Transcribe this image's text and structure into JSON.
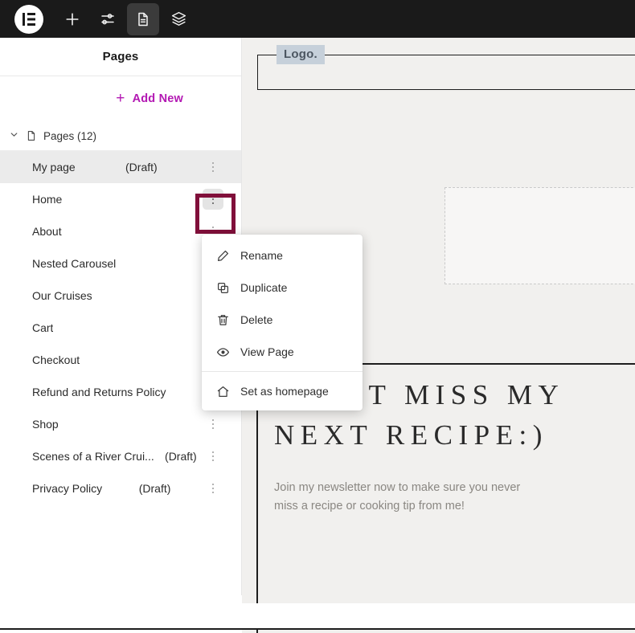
{
  "toolbar": {
    "items": [
      {
        "name": "elementor-logo",
        "label": "Elementor",
        "icon": "elementor-logo-icon"
      },
      {
        "name": "add-element",
        "label": "Add Element",
        "icon": "plus-icon"
      },
      {
        "name": "site-settings",
        "label": "Site Settings",
        "icon": "sliders-icon"
      },
      {
        "name": "pages",
        "label": "Pages",
        "icon": "document-icon",
        "active": true
      },
      {
        "name": "structure",
        "label": "Structure",
        "icon": "layers-icon"
      }
    ]
  },
  "panel": {
    "title": "Pages",
    "add_new_label": "Add New",
    "add_new_icon": "plus-icon",
    "group": {
      "label": "Pages (12)",
      "count": 12,
      "chevron_icon": "chevron-down-icon",
      "doc_icon": "document-icon",
      "expanded": true
    },
    "pages": [
      {
        "title": "My page",
        "status": "(Draft)",
        "selected": true,
        "kebab_highlight": false
      },
      {
        "title": "Home",
        "status": "",
        "selected": false,
        "kebab_highlight": true
      },
      {
        "title": "About",
        "status": "",
        "selected": false,
        "kebab_highlight": false
      },
      {
        "title": "Nested Carousel",
        "status": "",
        "selected": false,
        "kebab_highlight": false
      },
      {
        "title": "Our Cruises",
        "status": "",
        "selected": false,
        "kebab_highlight": false
      },
      {
        "title": "Cart",
        "status": "",
        "selected": false,
        "kebab_highlight": false
      },
      {
        "title": "Checkout",
        "status": "",
        "selected": false,
        "kebab_highlight": false
      },
      {
        "title": "Refund and Returns Policy",
        "status": "",
        "selected": false,
        "kebab_highlight": false
      },
      {
        "title": "Shop",
        "status": "",
        "selected": false,
        "kebab_highlight": false
      },
      {
        "title": "Scenes of a River Crui...",
        "status": "(Draft)",
        "selected": false,
        "kebab_highlight": false
      },
      {
        "title": "Privacy Policy",
        "status": "(Draft)",
        "selected": false,
        "kebab_highlight": false
      }
    ],
    "kebab_icon": "more-vertical-icon"
  },
  "context_menu": {
    "items": [
      {
        "label": "Rename",
        "icon": "pencil-icon",
        "separator_after": false
      },
      {
        "label": "Duplicate",
        "icon": "copy-icon",
        "separator_after": false
      },
      {
        "label": "Delete",
        "icon": "trash-icon",
        "separator_after": false
      },
      {
        "label": "View Page",
        "icon": "eye-icon",
        "separator_after": true
      },
      {
        "label": "Set as homepage",
        "icon": "home-icon",
        "separator_after": false
      }
    ]
  },
  "canvas": {
    "logo_text": "Logo.",
    "heading": "DON’T MISS MY",
    "heading_line2": "NEXT RECIPE:)",
    "paragraph_line1": "Join my newsletter now to make sure you never",
    "paragraph_line2": "miss a recipe or cooking tip from me!"
  },
  "colors": {
    "toolbar_bg": "#1a1a1a",
    "accent_purple": "#b318b3",
    "highlight_ring": "#800f3a",
    "canvas_bg": "#f1f0ee",
    "selected_row": "#ebebeb",
    "logo_chip_bg": "#c6d0da"
  }
}
